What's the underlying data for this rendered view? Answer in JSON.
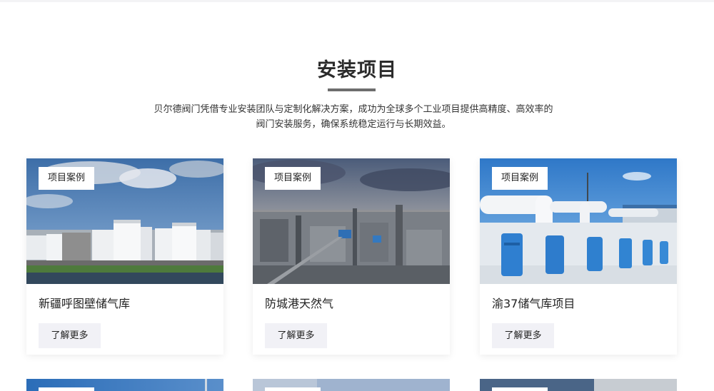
{
  "section": {
    "title": "安装项目",
    "intro": "贝尔德阀门凭借专业安装团队与定制化解决方案，成功为全球多个工业项目提供高精度、高效率的阀门安装服务，确保系统稳定运行与长期效益。"
  },
  "projects": [
    {
      "badge": "项目案例",
      "title": "新疆呼图壁储气库",
      "more": "了解更多"
    },
    {
      "badge": "项目案例",
      "title": "防城港天然气",
      "more": "了解更多"
    },
    {
      "badge": "项目案例",
      "title": "渝37储气库项目",
      "more": "了解更多"
    }
  ],
  "colors": {
    "button_bg": "#f1f1f6",
    "title_bar": "#6e6e6e",
    "text": "#222222"
  }
}
